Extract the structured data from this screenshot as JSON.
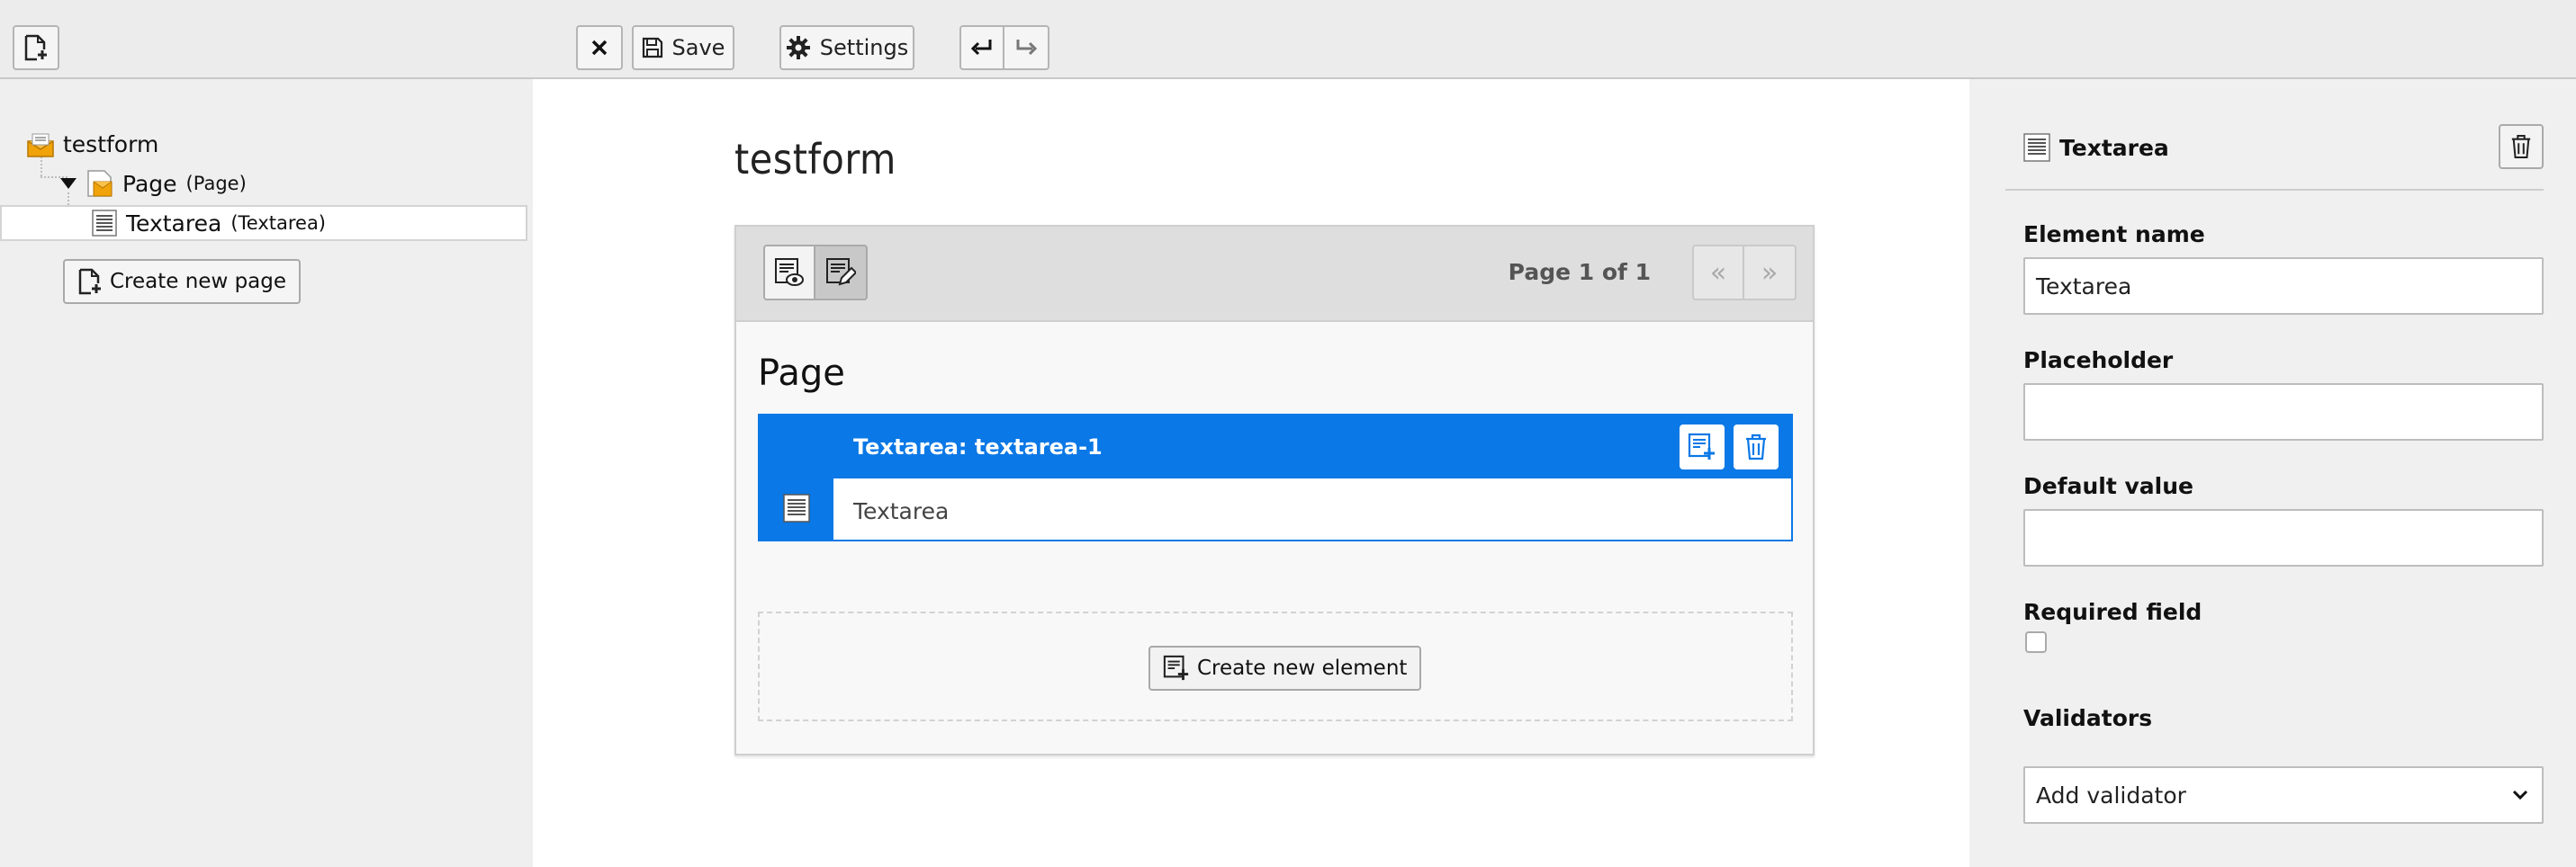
{
  "toolbar": {
    "new_form_icon": "document-plus-icon",
    "close_icon": "close-icon",
    "save_label": "Save",
    "settings_label": "Settings",
    "undo_icon": "undo-icon",
    "redo_icon": "redo-icon"
  },
  "tree": {
    "form_label": "testform",
    "page_label": "Page",
    "page_type": "(Page)",
    "element_label": "Textarea",
    "element_type": "(Textarea)",
    "create_page_label": "Create new page"
  },
  "stage": {
    "form_title": "testform",
    "page_info": "Page 1 of 1",
    "page_heading": "Page",
    "element_header": "Textarea: textarea-1",
    "element_body": "Textarea",
    "create_element_label": "Create new element",
    "prev_label": "«",
    "next_label": "»"
  },
  "inspector": {
    "title": "Textarea",
    "element_name_label": "Element name",
    "element_name_value": "Textarea",
    "placeholder_label": "Placeholder",
    "placeholder_value": "",
    "default_value_label": "Default value",
    "default_value_value": "",
    "required_label": "Required field",
    "required_checked": false,
    "validators_label": "Validators",
    "validator_select": "Add validator"
  },
  "colors": {
    "accent": "#0a78e6",
    "form_icon": "#f0a30a"
  }
}
